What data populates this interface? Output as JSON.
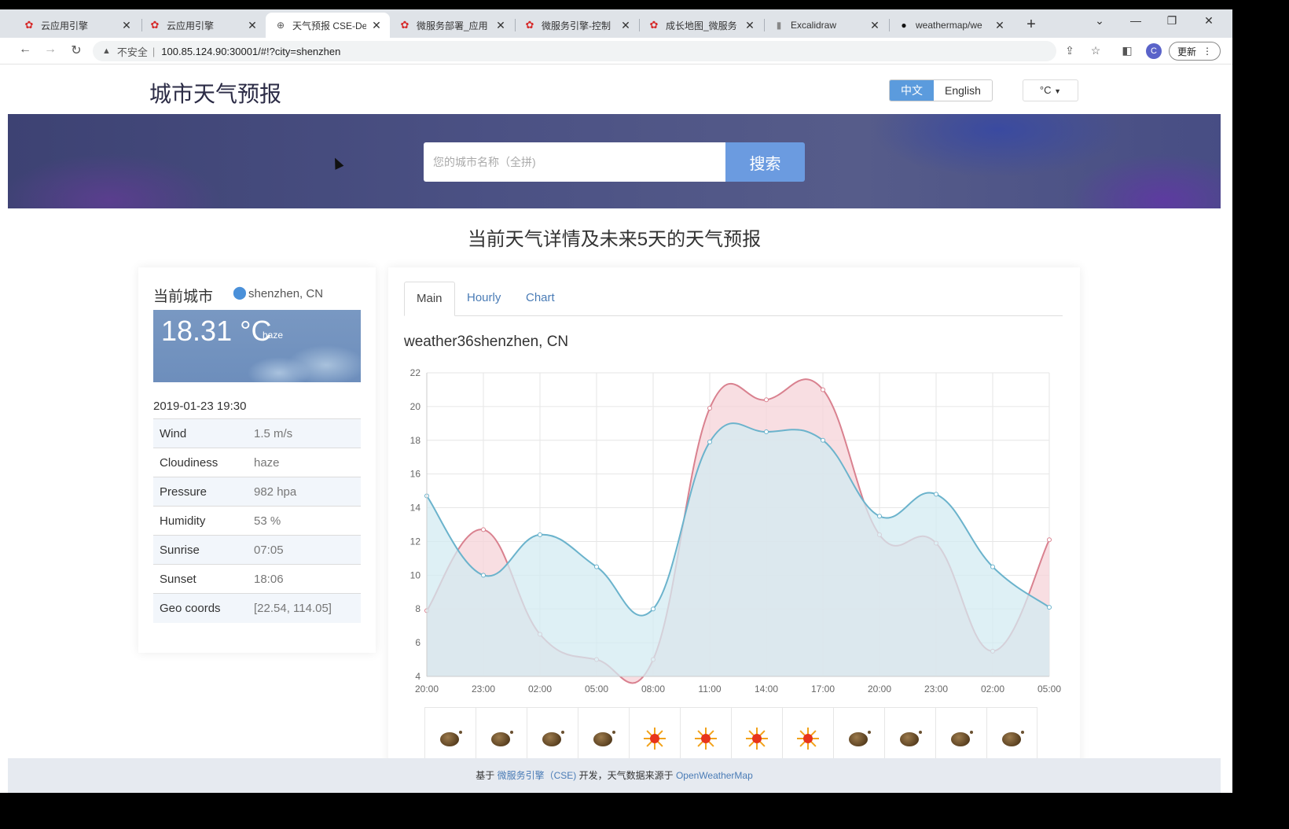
{
  "browser": {
    "tabs": [
      {
        "title": "云应用引擎",
        "favicon": "huawei-icon",
        "active": false
      },
      {
        "title": "云应用引擎",
        "favicon": "huawei-icon",
        "active": false
      },
      {
        "title": "天气预报 CSE-De",
        "favicon": "globe-icon",
        "active": true
      },
      {
        "title": "微服务部署_应用",
        "favicon": "huawei-icon",
        "active": false
      },
      {
        "title": "微服务引擎-控制",
        "favicon": "huawei-icon",
        "active": false
      },
      {
        "title": "成长地图_微服务",
        "favicon": "huawei-icon",
        "active": false
      },
      {
        "title": "Excalidraw",
        "favicon": "excalidraw-icon",
        "active": false
      },
      {
        "title": "weathermap/we",
        "favicon": "github-icon",
        "active": false
      }
    ],
    "address": {
      "security_label": "不安全",
      "url": "100.85.124.90:30001/#!?city=shenzhen"
    },
    "profile_initial": "C",
    "update_label": "更新"
  },
  "header": {
    "site_title": "城市天气预报",
    "lang_zh": "中文",
    "lang_en": "English",
    "unit": "°C"
  },
  "search": {
    "placeholder": "您的城市名称（全拼)",
    "button_label": "搜索"
  },
  "section_title": "当前天气详情及未来5天的天气预报",
  "current": {
    "label": "当前城市",
    "city": "shenzhen, CN",
    "temperature": "18.31 °C",
    "description": "haze",
    "time": "2019-01-23 19:30",
    "details": [
      {
        "key": "Wind",
        "value": "1.5 m/s"
      },
      {
        "key": "Cloudiness",
        "value": "haze"
      },
      {
        "key": "Pressure",
        "value": "982 hpa"
      },
      {
        "key": "Humidity",
        "value": "53 %"
      },
      {
        "key": "Sunrise",
        "value": "07:05"
      },
      {
        "key": "Sunset",
        "value": "18:06"
      },
      {
        "key": "Geo coords",
        "value": "[22.54, 114.05]"
      }
    ]
  },
  "forecast_tabs": [
    "Main",
    "Hourly",
    "Chart"
  ],
  "chart_heading": "weather36shenzhen, CN",
  "chart_data": {
    "type": "area",
    "x": [
      "20:00",
      "23:00",
      "02:00",
      "05:00",
      "08:00",
      "11:00",
      "14:00",
      "17:00",
      "20:00",
      "23:00",
      "02:00",
      "05:00"
    ],
    "ylim": [
      4,
      22
    ],
    "yticks": [
      4,
      6,
      8,
      10,
      12,
      14,
      16,
      18,
      20,
      22
    ],
    "grid": true,
    "series": [
      {
        "values": [
          7.9,
          12.7,
          6.5,
          5.0,
          5.0,
          19.9,
          20.4,
          21.0,
          12.4,
          11.9,
          5.5,
          12.1
        ],
        "color": "#d9818f",
        "fill": "#f6d3d8"
      },
      {
        "values": [
          14.7,
          10.0,
          12.4,
          10.5,
          8.0,
          17.9,
          18.5,
          18.0,
          13.5,
          14.8,
          10.5,
          8.1
        ],
        "color": "#6bb3cc",
        "fill": "#d3ebf1"
      }
    ]
  },
  "forecast_icons": [
    "haze-icon",
    "haze-icon",
    "haze-icon",
    "haze-icon",
    "sun-icon",
    "sun-icon",
    "sun-icon",
    "sun-icon",
    "haze-icon",
    "haze-icon",
    "haze-icon",
    "haze-icon"
  ],
  "footer": {
    "prefix": "基于",
    "engine_link": "微服务引擎（CSE)",
    "middle": "开发，天气数据来源于",
    "source_link": "OpenWeatherMap"
  }
}
